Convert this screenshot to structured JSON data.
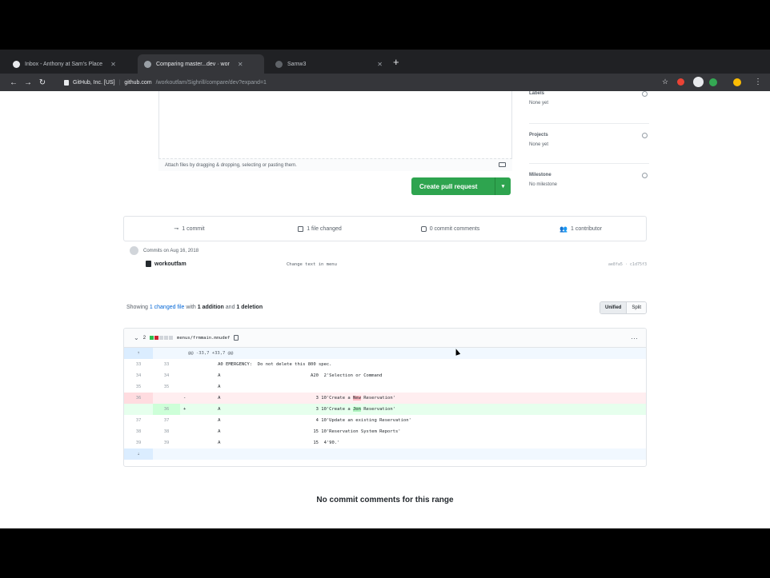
{
  "browser": {
    "tabs": [
      {
        "label": "Inbox - Anthony at Sam's Place"
      },
      {
        "label": "Comparing master...dev · wor"
      },
      {
        "label": "Samw3"
      }
    ],
    "new_tab": "+",
    "address": {
      "site": "GitHub, Inc. [US]",
      "host": "github.com",
      "path": "/workoutfam/Sighrill/compare/dev?expand=1"
    }
  },
  "sidebar": {
    "labels": {
      "title": "Labels",
      "value": "None yet"
    },
    "projects": {
      "title": "Projects",
      "value": "None yet"
    },
    "milestone": {
      "title": "Milestone",
      "value": "No milestone"
    }
  },
  "comment": {
    "attach_hint": "Attach files by dragging & dropping, selecting or pasting them.",
    "create_button": "Create pull request",
    "caret": "▾"
  },
  "summary": {
    "commits": "1 commit",
    "files_changed": "1 file changed",
    "commit_comments": "0 commit comments",
    "contributors": "1 contributor"
  },
  "commits": {
    "date": "Commits on Aug 16, 2018",
    "author": "workoutfam",
    "message": "Change text in menu",
    "sha": "ae8fa5 · c1d75f3"
  },
  "toc": {
    "prefix": "Showing",
    "link": "1 changed file",
    "middle": "with",
    "additions": "1 addition",
    "and": "and",
    "deletions": "1 deletion",
    "unified": "Unified",
    "split": "Split"
  },
  "file": {
    "toggle": "⌄",
    "count": "2",
    "path": "menus/frmmain.mnudef",
    "menu": "···",
    "hunk": "@@ -33,7 +33,7 @@",
    "lines": [
      {
        "ln1": "33",
        "ln2": "33",
        "sign": "",
        "code": "          A0 EMERGENCY:  Do not delete this 800 spec.",
        "type": "ctx"
      },
      {
        "ln1": "34",
        "ln2": "34",
        "sign": "",
        "code": "          A                                  A20  2'Selection or Command       ",
        "type": "ctx"
      },
      {
        "ln1": "35",
        "ln2": "35",
        "sign": "",
        "code": "          A",
        "type": "ctx"
      },
      {
        "ln1": "36",
        "ln2": "",
        "sign": "-",
        "code_before": "          A                                    3 10'Create a ",
        "code_hl": "New",
        "code_after": " Reservation'",
        "type": "del"
      },
      {
        "ln1": "",
        "ln2": "36",
        "sign": "+",
        "code_before": "          A                                    3 10'Create a ",
        "code_hl": "Jon",
        "code_after": " Reservation'",
        "type": "add"
      },
      {
        "ln1": "37",
        "ln2": "37",
        "sign": "",
        "code": "          A                                    4 10'Update an existing Reservation'",
        "type": "ctx"
      },
      {
        "ln1": "38",
        "ln2": "38",
        "sign": "",
        "code": "          A                                   15 10'Reservation System Reports'",
        "type": "ctx"
      },
      {
        "ln1": "39",
        "ln2": "39",
        "sign": "",
        "code": "          A                                   15  4'90.'",
        "type": "ctx"
      }
    ]
  },
  "footer": {
    "no_comments": "No commit comments for this range"
  },
  "colors": {
    "accent_green": "#2ea44f",
    "link_blue": "#0366d6",
    "del_bg": "#ffeef0",
    "add_bg": "#e6ffed"
  }
}
